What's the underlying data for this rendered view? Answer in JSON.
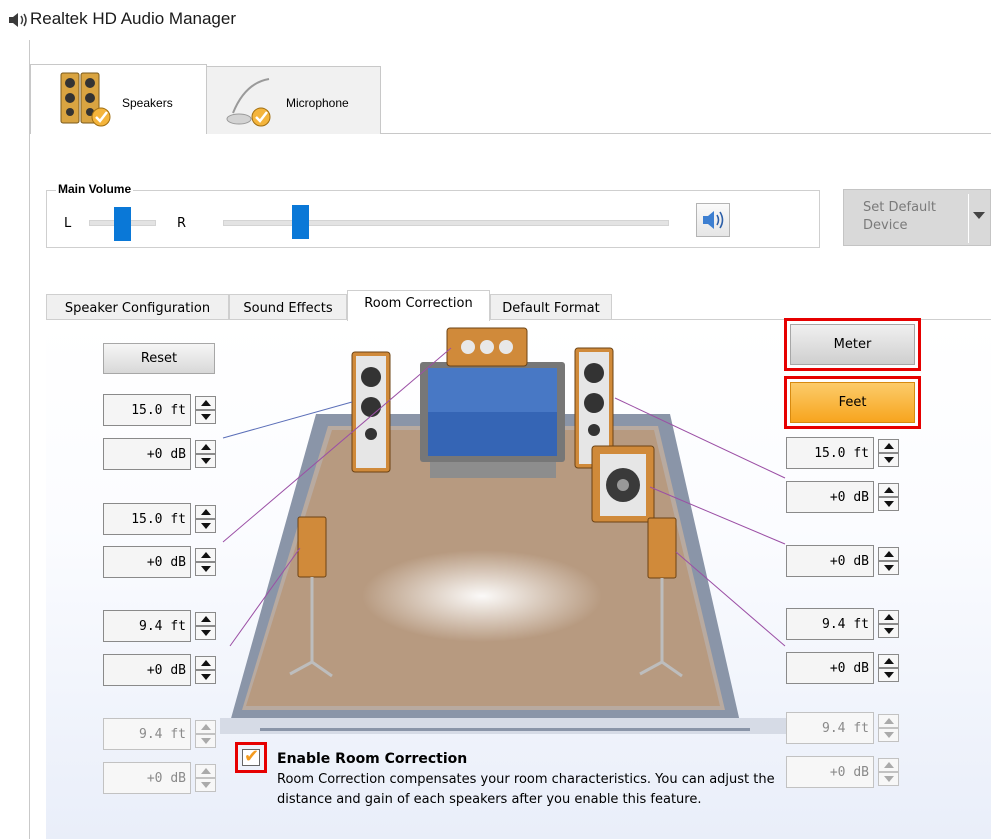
{
  "window": {
    "title": "Realtek HD Audio Manager",
    "icon": "speaker-volume-icon"
  },
  "device_tabs": [
    {
      "label": "Speakers",
      "icon": "speakers-icon",
      "selected": true
    },
    {
      "label": "Microphone",
      "icon": "microphone-icon",
      "selected": false
    }
  ],
  "main_volume": {
    "label": "Main Volume",
    "balance_left": "L",
    "balance_right": "R",
    "balance_level": 0.5,
    "volume_level": 0.16,
    "mute_icon": "speaker-sound-icon"
  },
  "set_default": {
    "label_line1": "Set Default",
    "label_line2": "Device"
  },
  "tabs": [
    {
      "label": "Speaker Configuration",
      "selected": false
    },
    {
      "label": "Sound Effects",
      "selected": false
    },
    {
      "label": "Room Correction",
      "selected": true
    },
    {
      "label": "Default Format",
      "selected": false
    }
  ],
  "room_correction": {
    "reset_label": "Reset",
    "meter_label": "Meter",
    "feet_label": "Feet",
    "left_controls": [
      {
        "value": "15.0 ft",
        "enabled": true
      },
      {
        "value": "+0 dB",
        "enabled": true
      },
      {
        "value": "15.0 ft",
        "enabled": true
      },
      {
        "value": "+0 dB",
        "enabled": true
      },
      {
        "value": "9.4 ft",
        "enabled": true
      },
      {
        "value": "+0 dB",
        "enabled": true
      },
      {
        "value": "9.4 ft",
        "enabled": false
      },
      {
        "value": "+0 dB",
        "enabled": false
      }
    ],
    "right_controls": [
      {
        "value": "15.0 ft",
        "enabled": true
      },
      {
        "value": "+0 dB",
        "enabled": true
      },
      {
        "value": "+0 dB",
        "enabled": true
      },
      {
        "value": "9.4 ft",
        "enabled": true
      },
      {
        "value": "+0 dB",
        "enabled": true
      },
      {
        "value": "9.4 ft",
        "enabled": false
      },
      {
        "value": "+0 dB",
        "enabled": false
      }
    ],
    "enable_checked": true,
    "enable_label": "Enable Room Correction",
    "description": "Room Correction compensates your room characteristics. You can adjust the distance and gain of each speakers after you enable this feature."
  },
  "colors": {
    "accent": "#0a78d7",
    "highlight": "#e60000",
    "active_button": "#f9b233",
    "check": "#f39a1e"
  }
}
